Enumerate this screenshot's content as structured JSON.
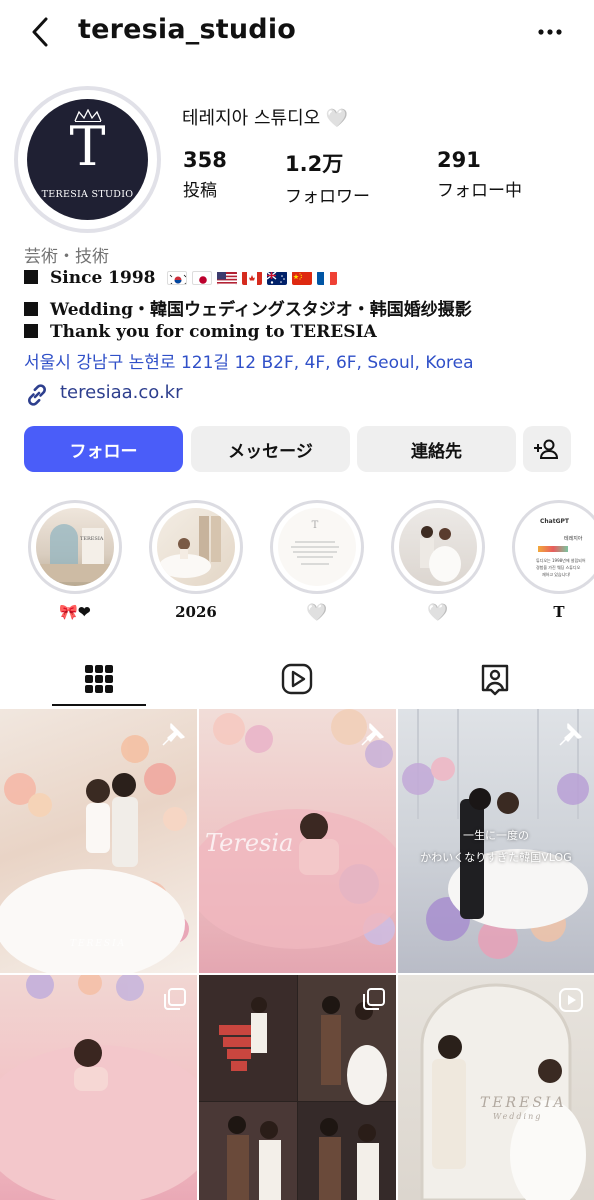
{
  "header": {
    "username": "teresia_studio"
  },
  "profile": {
    "avatar_monogram": "T",
    "avatar_text": "TERESIA STUDIO",
    "display_name": "테레지아 스튜디오 🤍",
    "stats": [
      {
        "value": "358",
        "label": "投稿"
      },
      {
        "value": "1.2万",
        "label": "フォロワー"
      },
      {
        "value": "291",
        "label": "フォロー中"
      }
    ],
    "category": "芸術・技術",
    "bio": [
      "Since 1998",
      "Wedding・韓国ウェディングスタジオ・韩国婚纱摄影",
      "Thank you for coming to TERESIA"
    ],
    "flags": [
      "kr",
      "jp",
      "us",
      "ca",
      "au",
      "cn",
      "fr"
    ],
    "address": "서울시 강남구 논현로 121길 12 B2F, 4F, 6F, Seoul, Korea",
    "website": "teresiaa.co.kr"
  },
  "actions": {
    "follow": "フォロー",
    "message": "メッセージ",
    "contact": "連絡先"
  },
  "highlights": [
    {
      "caption": "🎀❤"
    },
    {
      "caption": "2026"
    },
    {
      "caption": "🤍"
    },
    {
      "caption": "🤍"
    },
    {
      "caption": "T"
    }
  ],
  "highlight_texts": {
    "h1_label": "TERESIA",
    "h5_title": "ChatGPT",
    "h5_sub": "테레지아",
    "h5_line1": "튜디오는 1998년에 설립되어",
    "h5_line2": "경험을 가진 웨딩 스튜디오",
    "h5_line3": "재하고 있습니다!"
  },
  "grid": {
    "tile1_watermark": "TERESIA",
    "tile2_watermark": "Teresia",
    "tile3_overlay_line1": "一生に一度の",
    "tile3_overlay_line2": "かわいくなりすぎた韓国VLOG",
    "tile6_watermark": "TERESIA",
    "tile6_sub": "Wedding"
  },
  "colors": {
    "primary_button": "#4a5df9",
    "link": "#3050c8",
    "avatar_bg": "#1f2033"
  }
}
